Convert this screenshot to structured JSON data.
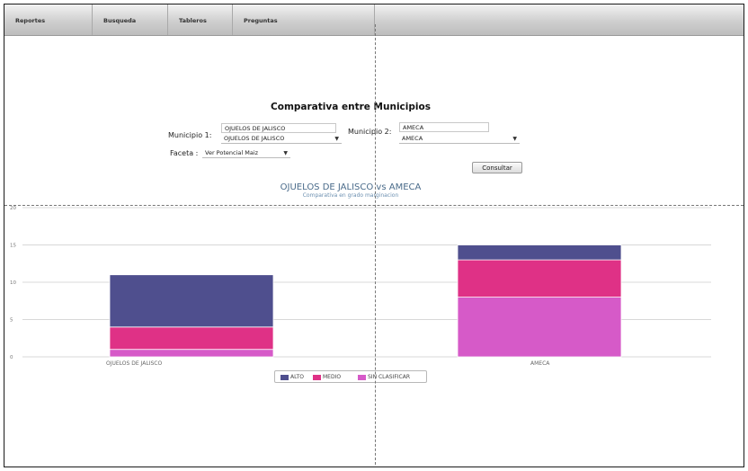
{
  "menu": [
    {
      "label": "Reportes"
    },
    {
      "label": "Busqueda"
    },
    {
      "label": "Tableros"
    },
    {
      "label": "Preguntas"
    }
  ],
  "form": {
    "title": "Comparativa entre Municipios",
    "municipio1_label": "Municipio 1:",
    "municipio1_input": "OJUELOS DE JALISCO",
    "municipio1_select": "OJUELOS DE JALISCO",
    "municipio2_label": "Municipio 2:",
    "municipio2_input": "AMECA",
    "municipio2_select": "AMECA",
    "faceta_label": "Faceta :",
    "faceta_select": "Ver Potencial Maiz",
    "consultar": "Consultar"
  },
  "chart_data": {
    "type": "bar",
    "stacked": true,
    "title": "OJUELOS DE JALISCO vs AMECA",
    "subtitle": "Comparativa en grado marginacion",
    "categories": [
      "OJUELOS DE JALISCO",
      "AMECA"
    ],
    "series": [
      {
        "name": "SIN CLASIFICAR",
        "color": "#d65ac8",
        "values": [
          1,
          8
        ]
      },
      {
        "name": "MEDIO",
        "color": "#df3186",
        "values": [
          3,
          5
        ]
      },
      {
        "name": "ALTO",
        "color": "#4f4f8e",
        "values": [
          7,
          2
        ]
      }
    ],
    "legend_order": [
      "ALTO",
      "MEDIO",
      "SIN CLASIFICAR"
    ],
    "yticks": [
      "0",
      "5",
      "10",
      "15",
      "20"
    ],
    "ylim": [
      0,
      20
    ],
    "grid": true,
    "legend": "bottom-center"
  }
}
